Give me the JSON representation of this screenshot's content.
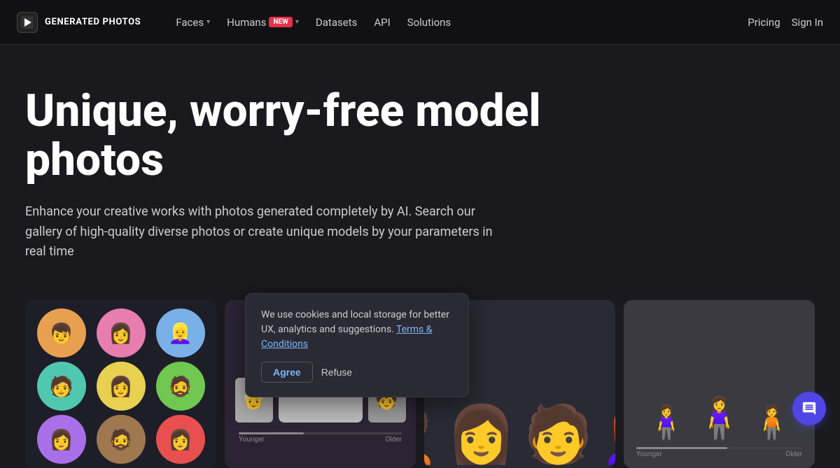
{
  "brand": {
    "name": "GENERATED PHOTOS",
    "logo_icon": "▶"
  },
  "nav": {
    "links": [
      {
        "label": "Faces",
        "has_dropdown": true,
        "badge": null
      },
      {
        "label": "Humans",
        "has_dropdown": true,
        "badge": "New"
      },
      {
        "label": "Datasets",
        "has_dropdown": false,
        "badge": null
      },
      {
        "label": "API",
        "has_dropdown": false,
        "badge": null
      },
      {
        "label": "Solutions",
        "has_dropdown": false,
        "badge": null
      }
    ],
    "pricing": "Pricing",
    "signin": "Sign In"
  },
  "hero": {
    "title": "Unique, worry-free model photos",
    "subtitle": "Enhance your creative works with photos generated completely by AI. Search our gallery of high-quality diverse photos or create unique models by your parameters in real time"
  },
  "cards": [
    {
      "id": "face-grid",
      "type": "faces"
    },
    {
      "id": "face-detail",
      "type": "detail",
      "slider_left": "Younger",
      "slider_right": "Older"
    },
    {
      "id": "full-body",
      "type": "body"
    },
    {
      "id": "3d-body",
      "type": "3d",
      "slider_left": "Younger",
      "slider_right": "Older"
    }
  ],
  "cookie": {
    "message": "We use cookies and local storage for better UX, analytics and suggestions.",
    "link_text": "Terms & Conditions",
    "agree_label": "Agree",
    "refuse_label": "Refuse"
  }
}
